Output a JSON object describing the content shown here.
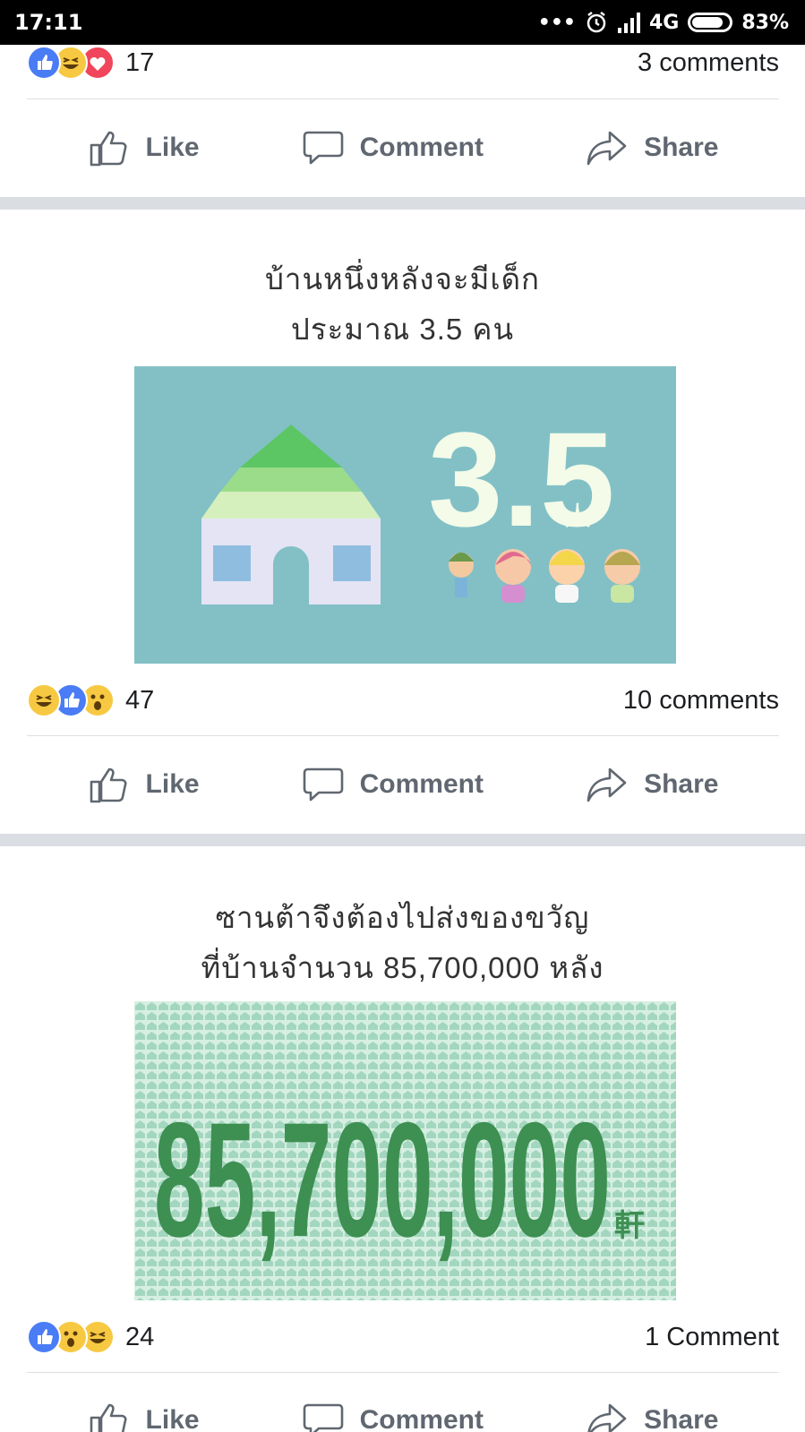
{
  "status_bar": {
    "time": "17:11",
    "network": "4G",
    "battery": "83%",
    "battery_level": 0.83
  },
  "posts": [
    {
      "reaction_icons": [
        "like-icon",
        "haha-icon",
        "love-icon"
      ],
      "reaction_count": "17",
      "comment_count": "3 comments"
    },
    {
      "caption_line1": "บ้านหนึ่งหลังจะมีเด็ก",
      "caption_line2": "ประมาณ 3.5 คน",
      "image_number": "3.5",
      "image_unit": "人",
      "reaction_icons": [
        "haha-icon",
        "like-icon",
        "wow-icon"
      ],
      "reaction_count": "47",
      "comment_count": "10 comments"
    },
    {
      "caption_line1": "ซานต้าจึงต้องไปส่งของขวัญ",
      "caption_line2": "ที่บ้านจำนวน 85,700,000 หลัง",
      "image_number": "85,700,000",
      "image_unit": "軒",
      "reaction_icons": [
        "like-icon",
        "wow-icon",
        "haha-icon"
      ],
      "reaction_count": "24",
      "comment_count": "1 Comment"
    }
  ],
  "actions": {
    "like": "Like",
    "comment": "Comment",
    "share": "Share"
  },
  "colors": {
    "like_blue": "#4a7cf6",
    "haha_yellow": "#f7c942",
    "love_red": "#f0455b",
    "action_gray": "#606770",
    "teal_bg": "#82c0c6",
    "green_tile": "#a9dcc4"
  }
}
